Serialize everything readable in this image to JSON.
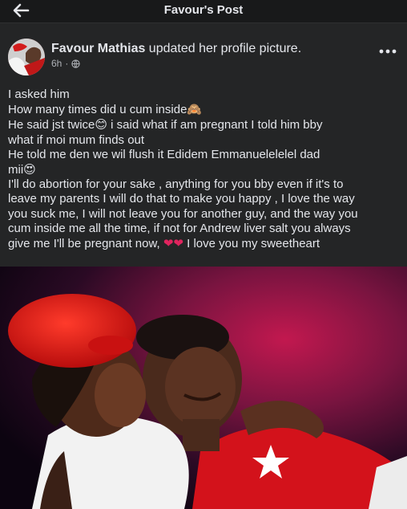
{
  "topbar": {
    "title": "Favour's Post",
    "back_icon": "arrow-left-icon"
  },
  "post": {
    "author": "Favour Mathias",
    "action": " updated her profile picture.",
    "time": "6h",
    "separator": " · ",
    "privacy_icon": "globe-icon",
    "more_icon": "more-horizontal-icon",
    "lines": [
      "I asked him",
      "How many times did u cum inside",
      "He said jst twice",
      " i said what if am pregnant I told him bby",
      "what if moi mum finds out",
      "He told me den we wil flush it Edidem Emmanuelelelel dad",
      "mii",
      "I'll do abortion for your sake , anything for you bby even if it's to",
      "leave my parents I will do that to make you happy , I love the way",
      "you suck me, I will not leave you for another guy, and the way you",
      "cum inside me all the time, if not for Andrew liver salt you always",
      "give me I'll be pregnant now, ",
      " I love you my sweetheart"
    ],
    "emojis": {
      "hiding_face": "🙈",
      "smiling": "😊",
      "heart_eyes": "😍",
      "hearts": "❤❤"
    },
    "photo": "profile-photo-couple-embrace"
  },
  "colors": {
    "background": "#242526",
    "topbar": "#18191a",
    "text": "#e4e6eb",
    "secondary_text": "#b0b3b8",
    "heart": "#e0245e",
    "hat_red": "#e01a1a"
  }
}
